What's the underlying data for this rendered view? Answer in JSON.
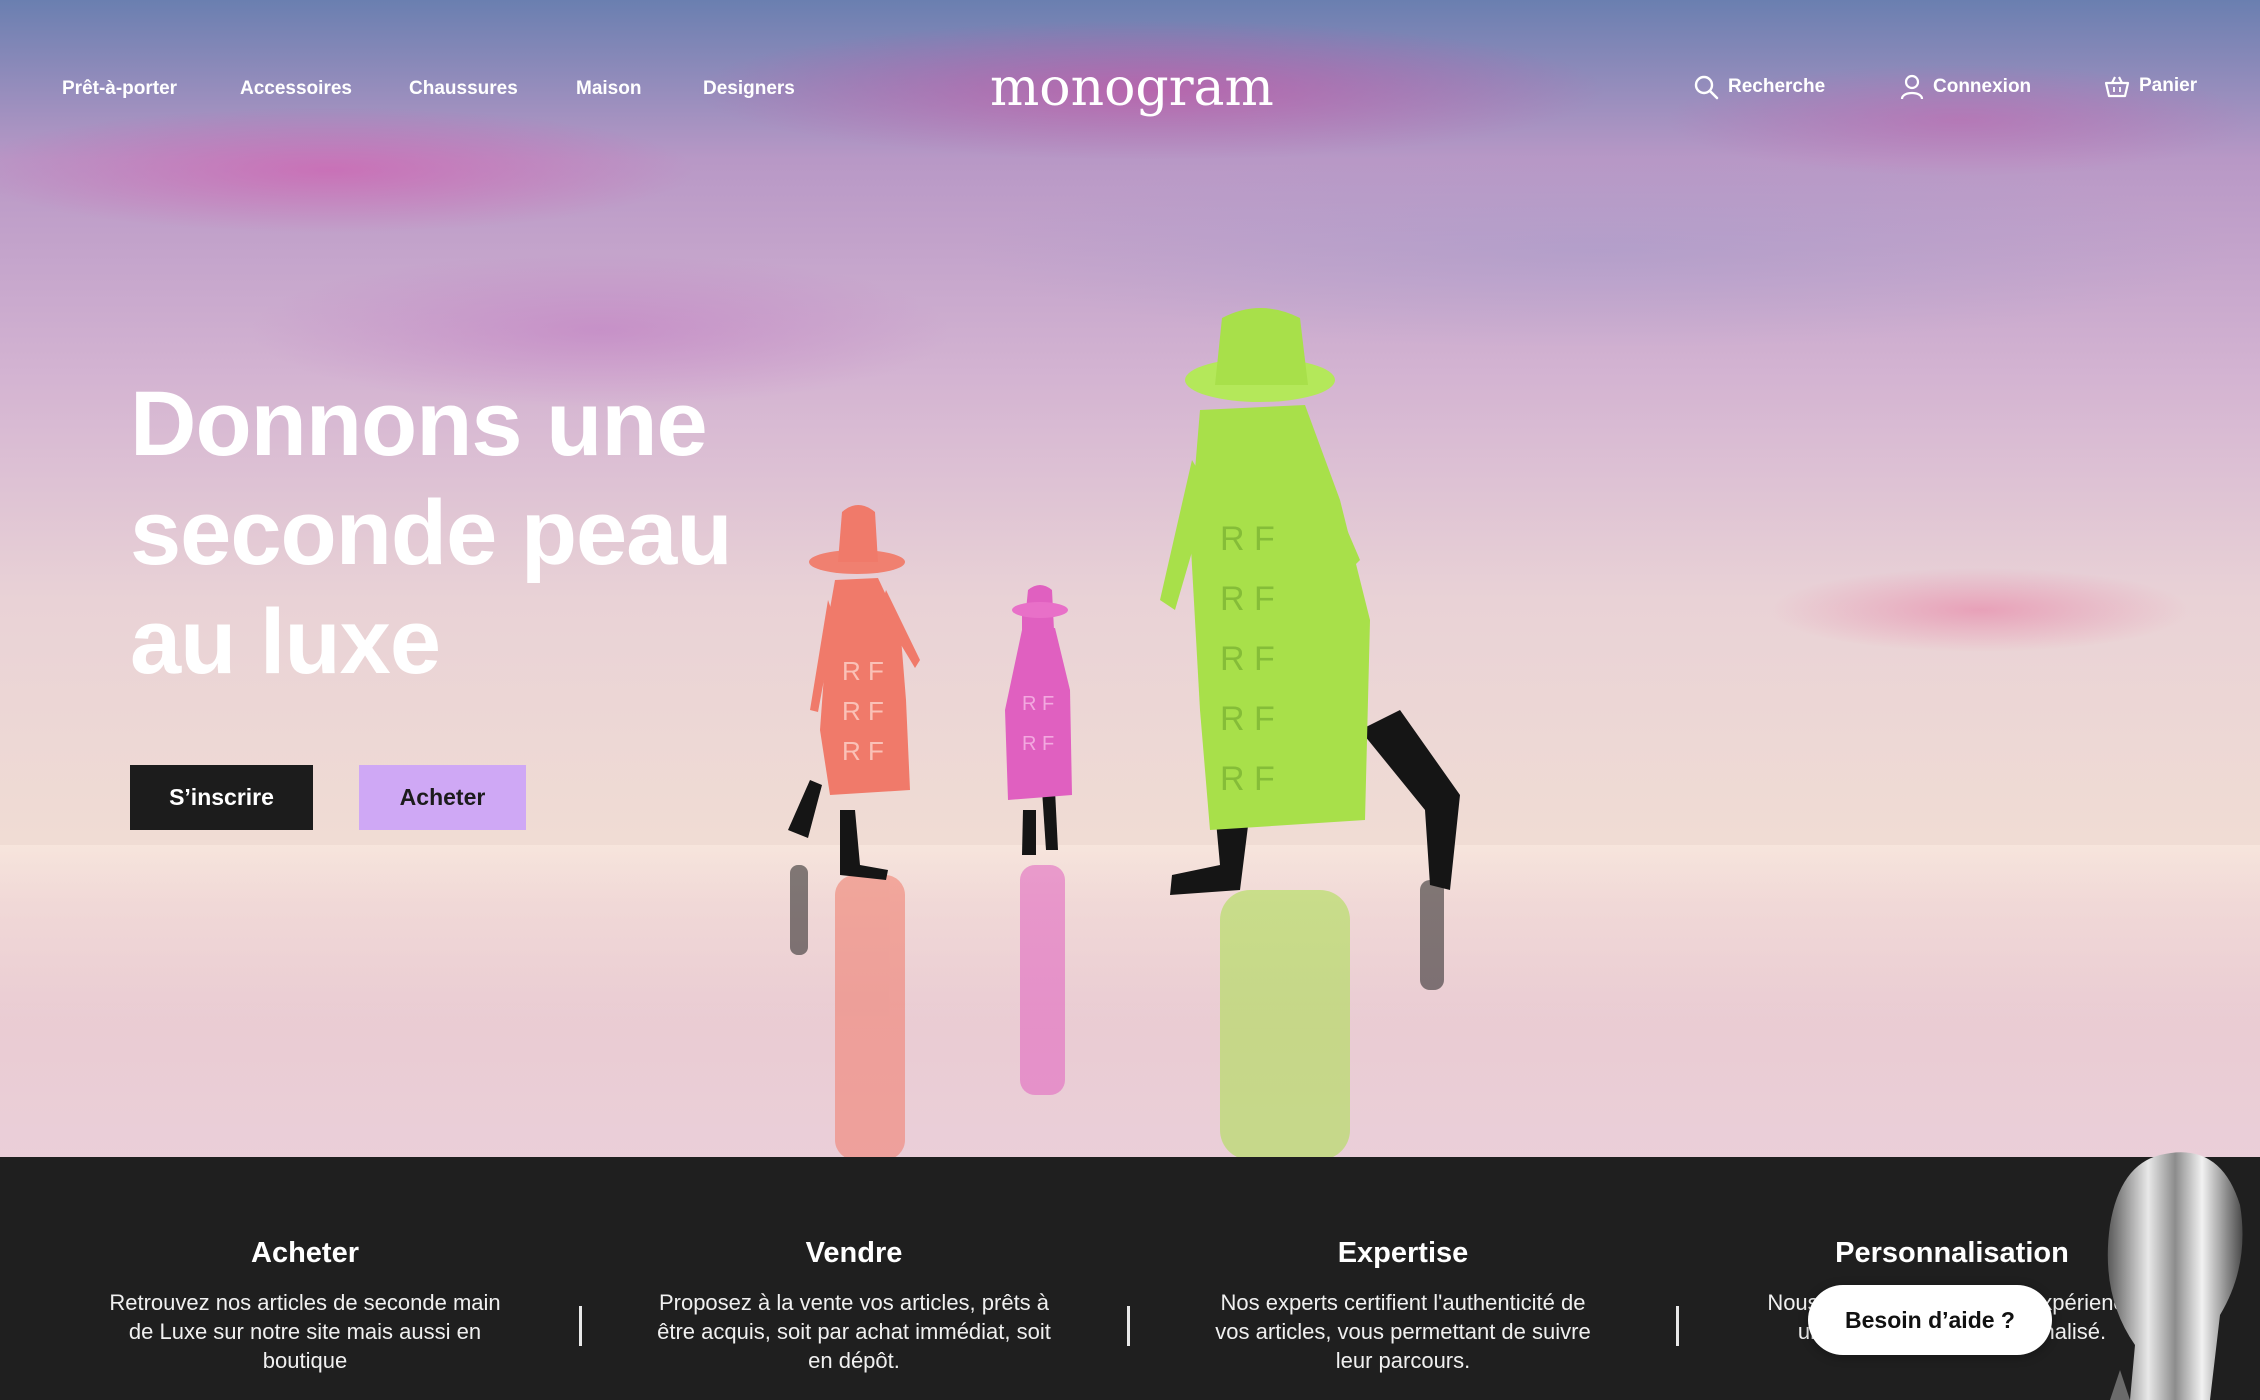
{
  "nav": {
    "links": [
      "Prêt-à-porter",
      "Accessoires",
      "Chaussures",
      "Maison",
      "Designers"
    ],
    "logo": "monogram",
    "search_label": "Recherche",
    "login_label": "Connexion",
    "cart_label": "Panier"
  },
  "hero": {
    "headline_lines": [
      "Donnons une",
      "seconde peau",
      "au luxe"
    ],
    "primary_button": "S’inscrire",
    "secondary_button": "Acheter"
  },
  "features": [
    {
      "title": "Acheter",
      "text": "Retrouvez nos articles de seconde main de Luxe sur notre site mais aussi en boutique"
    },
    {
      "title": "Vendre",
      "text": "Proposez à la vente vos articles, prêts à être acquis, soit par achat immédiat, soit en dépôt."
    },
    {
      "title": "Expertise",
      "text": "Nos experts certifient l'authenticité de vos articles, vous permettant de suivre leur parcours."
    },
    {
      "title": "Personnalisation",
      "text": "Nous vous proposons une expérience unique et un suivi personnalisé."
    }
  ],
  "help_button": "Besoin d’aide ?",
  "colors": {
    "dark": "#1f1f1f",
    "accent_button": "#cfa8f5",
    "figure_coral": "#f07a6a",
    "figure_pink": "#e060c0",
    "figure_green": "#a8e04a"
  },
  "icons": [
    "search-icon",
    "user-icon",
    "basket-icon"
  ]
}
